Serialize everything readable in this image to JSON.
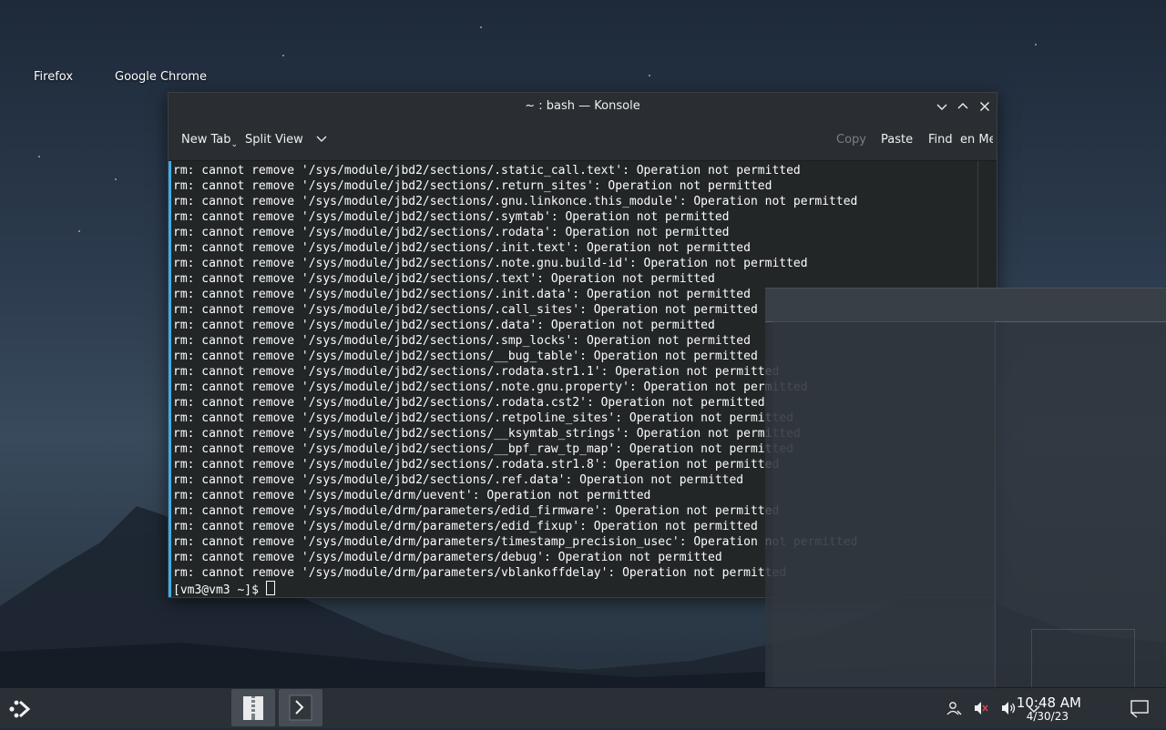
{
  "desktop": {
    "icons": [
      "Firefox",
      "Google Chrome"
    ]
  },
  "window": {
    "title": "~ : bash — Konsole"
  },
  "toolbar": {
    "new_tab": "New Tab",
    "split_view": "Split View",
    "copy": "Copy",
    "paste": "Paste",
    "find": "Find",
    "menu": "en Me"
  },
  "terminal": {
    "lines": [
      "rm: cannot remove '/sys/module/jbd2/sections/.static_call.text': Operation not permitted",
      "rm: cannot remove '/sys/module/jbd2/sections/.return_sites': Operation not permitted",
      "rm: cannot remove '/sys/module/jbd2/sections/.gnu.linkonce.this_module': Operation not permitted",
      "rm: cannot remove '/sys/module/jbd2/sections/.symtab': Operation not permitted",
      "rm: cannot remove '/sys/module/jbd2/sections/.rodata': Operation not permitted",
      "rm: cannot remove '/sys/module/jbd2/sections/.init.text': Operation not permitted",
      "rm: cannot remove '/sys/module/jbd2/sections/.note.gnu.build-id': Operation not permitted",
      "rm: cannot remove '/sys/module/jbd2/sections/.text': Operation not permitted",
      "rm: cannot remove '/sys/module/jbd2/sections/.init.data': Operation not permitted",
      "rm: cannot remove '/sys/module/jbd2/sections/.call_sites': Operation not permitted",
      "rm: cannot remove '/sys/module/jbd2/sections/.data': Operation not permitted",
      "rm: cannot remove '/sys/module/jbd2/sections/.smp_locks': Operation not permitted",
      "rm: cannot remove '/sys/module/jbd2/sections/__bug_table': Operation not permitted",
      "rm: cannot remove '/sys/module/jbd2/sections/.rodata.str1.1': Operation not permitted",
      "rm: cannot remove '/sys/module/jbd2/sections/.note.gnu.property': Operation not permitted",
      "rm: cannot remove '/sys/module/jbd2/sections/.rodata.cst2': Operation not permitted",
      "rm: cannot remove '/sys/module/jbd2/sections/.retpoline_sites': Operation not permitted",
      "rm: cannot remove '/sys/module/jbd2/sections/__ksymtab_strings': Operation not permitted",
      "rm: cannot remove '/sys/module/jbd2/sections/__bpf_raw_tp_map': Operation not permitted",
      "rm: cannot remove '/sys/module/jbd2/sections/.rodata.str1.8': Operation not permitted",
      "rm: cannot remove '/sys/module/jbd2/sections/.ref.data': Operation not permitted",
      "rm: cannot remove '/sys/module/drm/uevent': Operation not permitted",
      "rm: cannot remove '/sys/module/drm/parameters/edid_firmware': Operation not permitted",
      "rm: cannot remove '/sys/module/drm/parameters/edid_fixup': Operation not permitted",
      "rm: cannot remove '/sys/module/drm/parameters/timestamp_precision_usec': Operation not permitted",
      "rm: cannot remove '/sys/module/drm/parameters/debug': Operation not permitted",
      "rm: cannot remove '/sys/module/drm/parameters/vblankoffdelay': Operation not permitted"
    ],
    "prompt": "[vm3@vm3 ~]$ "
  },
  "taskbar": {
    "time": "10:48 AM",
    "date": "4/30/23",
    "tray_icons": [
      "user-icon",
      "speaker-muted-icon",
      "volume-icon",
      "chevron-up-icon"
    ]
  }
}
